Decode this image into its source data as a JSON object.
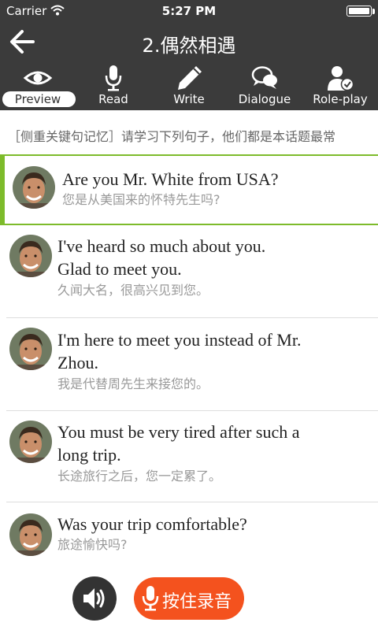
{
  "status": {
    "carrier": "Carrier",
    "time": "5:27 PM"
  },
  "nav": {
    "title": "2.偶然相遇"
  },
  "tabs": [
    {
      "label": "Preview",
      "icon": "eye-icon",
      "active": true
    },
    {
      "label": "Read",
      "icon": "microphone-icon",
      "active": false
    },
    {
      "label": "Write",
      "icon": "pencil-icon",
      "active": false
    },
    {
      "label": "Dialogue",
      "icon": "speech-bubbles-icon",
      "active": false
    },
    {
      "label": "Role-play",
      "icon": "person-check-icon",
      "active": false
    }
  ],
  "intro": "［侧重关键句记忆］请学习下列句子，他们都是本话题最常",
  "sentences": [
    {
      "en": [
        "Are you Mr. White from USA?"
      ],
      "zh": "您是从美国来的怀特先生吗?",
      "selected": true
    },
    {
      "en": [
        "I've heard so much about you.",
        "Glad to meet you."
      ],
      "zh": "久闻大名，很高兴见到您。",
      "selected": false
    },
    {
      "en": [
        "I'm here to meet you instead of Mr.",
        "Zhou."
      ],
      "zh": "我是代替周先生来接您的。",
      "selected": false
    },
    {
      "en": [
        "You must be very tired after such a",
        "long trip."
      ],
      "zh": "长途旅行之后，您一定累了。",
      "selected": false
    },
    {
      "en": [
        "Was your trip comfortable?"
      ],
      "zh": "旅途愉快吗?",
      "selected": false
    }
  ],
  "controls": {
    "record_label": "按住录音"
  },
  "colors": {
    "bar": "#3b3b3b",
    "accent_green": "#7dbb2b",
    "record_orange": "#f4521e"
  }
}
